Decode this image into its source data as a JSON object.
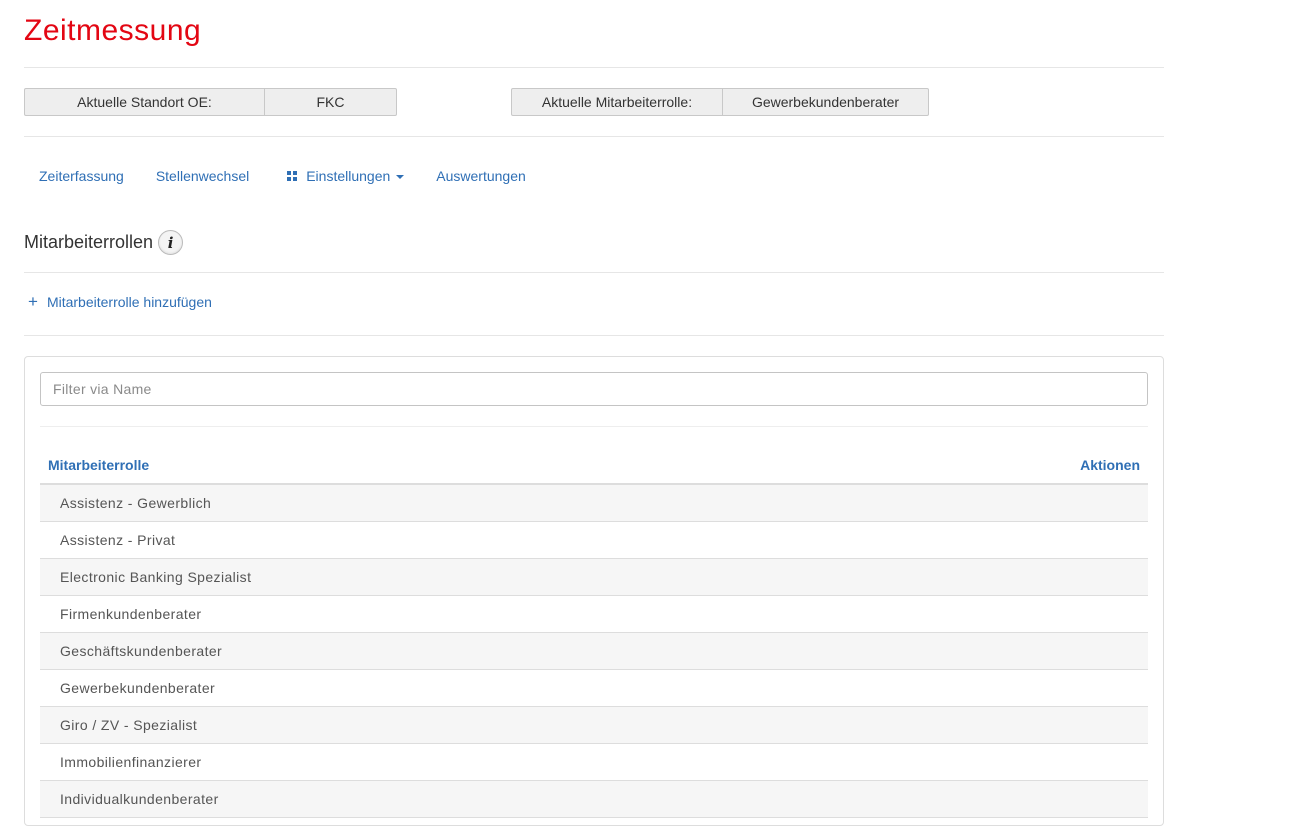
{
  "app": {
    "title": "Zeitmessung"
  },
  "context": {
    "location_label": "Aktuelle Standort OE:",
    "location_value": "FKC",
    "role_label": "Aktuelle Mitarbeiterrolle:",
    "role_value": "Gewerbekundenberater"
  },
  "nav": {
    "items": [
      {
        "label": "Zeiterfassung"
      },
      {
        "label": "Stellenwechsel"
      },
      {
        "label": "Einstellungen",
        "icon": "grid-icon",
        "dropdown": true
      },
      {
        "label": "Auswertungen"
      }
    ]
  },
  "section": {
    "title": "Mitarbeiterrollen",
    "info_icon": "info-icon",
    "add_label": "Mitarbeiterrolle hinzufügen"
  },
  "filter": {
    "placeholder": "Filter via Name",
    "value": ""
  },
  "table": {
    "columns": [
      "Mitarbeiterrolle",
      "Aktionen"
    ],
    "rows": [
      "Assistenz - Gewerblich",
      "Assistenz - Privat",
      "Electronic Banking Spezialist",
      "Firmenkundenberater",
      "Geschäftskundenberater",
      "Gewerbekundenberater",
      "Giro / ZV - Spezialist",
      "Immobilienfinanzierer",
      "Individualkundenberater"
    ]
  },
  "colors": {
    "brand_red": "#e30613",
    "link_blue": "#2f6fb5"
  }
}
